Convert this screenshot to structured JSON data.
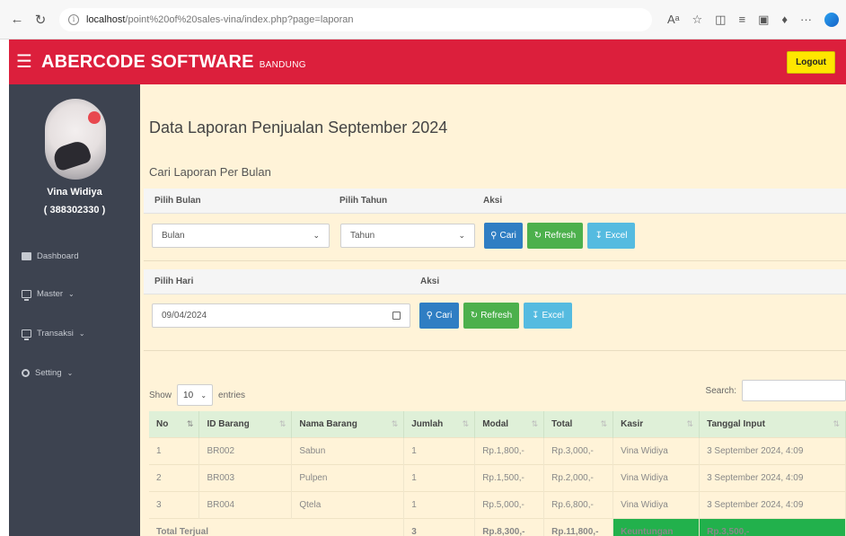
{
  "browser": {
    "url_host": "localhost",
    "url_rest": "/point%20of%20sales-vina/index.php?page=laporan"
  },
  "header": {
    "brand": "ABERCODE SOFTWARE",
    "brand_sub": "BANDUNG",
    "logout_label": "Logout"
  },
  "sidebar": {
    "user_name": "Vina Widiya",
    "user_id": "( 388302330 )",
    "items": [
      {
        "label": "Dashboard",
        "icon": "dashboard-icon"
      },
      {
        "label": "Master",
        "icon": "monitor-icon"
      },
      {
        "label": "Transaksi",
        "icon": "monitor-icon"
      },
      {
        "label": "Setting",
        "icon": "gear-icon"
      }
    ]
  },
  "main": {
    "title": "Data Laporan Penjualan September 2024",
    "subtitle": "Cari Laporan Per Bulan",
    "month_filter": {
      "month_label": "Pilih Bulan",
      "year_label": "Pilih Tahun",
      "action_label": "Aksi",
      "month_value": "Bulan",
      "year_value": "Tahun"
    },
    "day_filter": {
      "day_label": "Pilih Hari",
      "action_label": "Aksi",
      "date_value": "09/04/2024"
    },
    "buttons": {
      "search": "Cari",
      "refresh": "Refresh",
      "excel": "Excel"
    },
    "table_controls": {
      "show_label": "Show",
      "entries_value": "10",
      "entries_label": "entries",
      "search_label": "Search:"
    },
    "table": {
      "headers": [
        "No",
        "ID Barang",
        "Nama Barang",
        "Jumlah",
        "Modal",
        "Total",
        "Kasir",
        "Tanggal Input"
      ],
      "rows": [
        [
          "1",
          "BR002",
          "Sabun",
          "1",
          "Rp.1,800,-",
          "Rp.3,000,-",
          "Vina Widiya",
          "3 September 2024, 4:09"
        ],
        [
          "2",
          "BR003",
          "Pulpen",
          "1",
          "Rp.1,500,-",
          "Rp.2,000,-",
          "Vina Widiya",
          "3 September 2024, 4:09"
        ],
        [
          "3",
          "BR004",
          "Qtela",
          "1",
          "Rp.5,000,-",
          "Rp.6,800,-",
          "Vina Widiya",
          "3 September 2024, 4:09"
        ]
      ],
      "total_row": {
        "label": "Total Terjual",
        "jumlah": "3",
        "modal": "Rp.8,300,-",
        "total": "Rp.11,800,-",
        "profit_label": "Keuntungan",
        "profit_value": "Rp.3,500,-"
      }
    }
  }
}
